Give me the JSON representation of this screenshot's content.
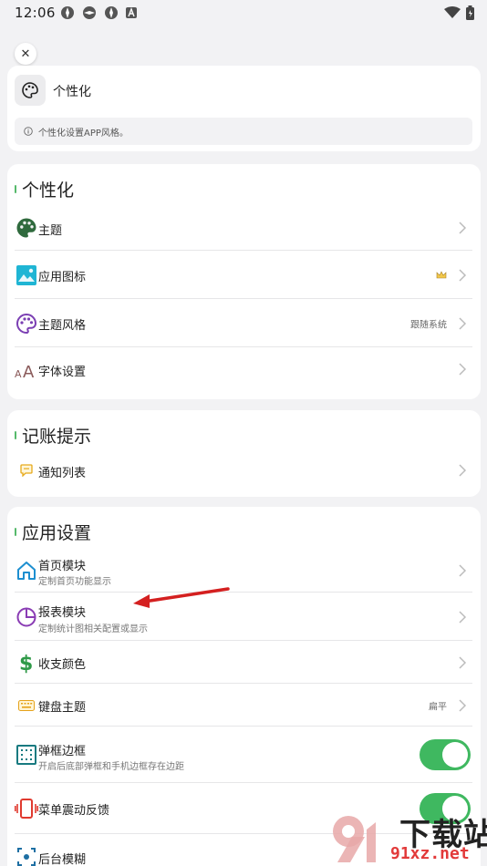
{
  "status_bar": {
    "time": "12:06"
  },
  "header_card": {
    "title": "个性化",
    "note": "个性化设置APP风格。"
  },
  "personalize": {
    "title": "个性化",
    "items": [
      {
        "label": "主题",
        "icon": "palette-icon"
      },
      {
        "label": "应用图标",
        "icon": "image-icon",
        "badge": "crown-icon"
      },
      {
        "label": "主题风格",
        "icon": "palette-outline-icon",
        "value": "跟随系统"
      },
      {
        "label": "字体设置",
        "icon": "font-size-icon"
      }
    ]
  },
  "reminder": {
    "title": "记账提示",
    "items": [
      {
        "label": "通知列表",
        "icon": "chat-icon"
      }
    ]
  },
  "app_settings": {
    "title": "应用设置",
    "items": [
      {
        "label": "首页模块",
        "sub": "定制首页功能显示",
        "icon": "home-icon"
      },
      {
        "label": "报表模块",
        "sub": "定制统计图相关配置或显示",
        "icon": "pie-chart-icon"
      },
      {
        "label": "收支颜色",
        "icon": "dollar-icon"
      },
      {
        "label": "键盘主题",
        "icon": "keyboard-icon",
        "value": "扁平"
      },
      {
        "label": "弹框边框",
        "sub": "开启后底部弹框和手机边框存在边距",
        "icon": "frame-icon",
        "toggle": true
      },
      {
        "label": "菜单震动反馈",
        "icon": "vibration-icon",
        "toggle": true
      },
      {
        "label": "后台模糊",
        "icon": "blur-icon"
      }
    ]
  },
  "watermark": {
    "text": "下载站",
    "domain": "91xz.net"
  },
  "colors": {
    "accent_green": "#3fb860",
    "background": "#f2f2f4",
    "arrow_red": "#d42020"
  }
}
